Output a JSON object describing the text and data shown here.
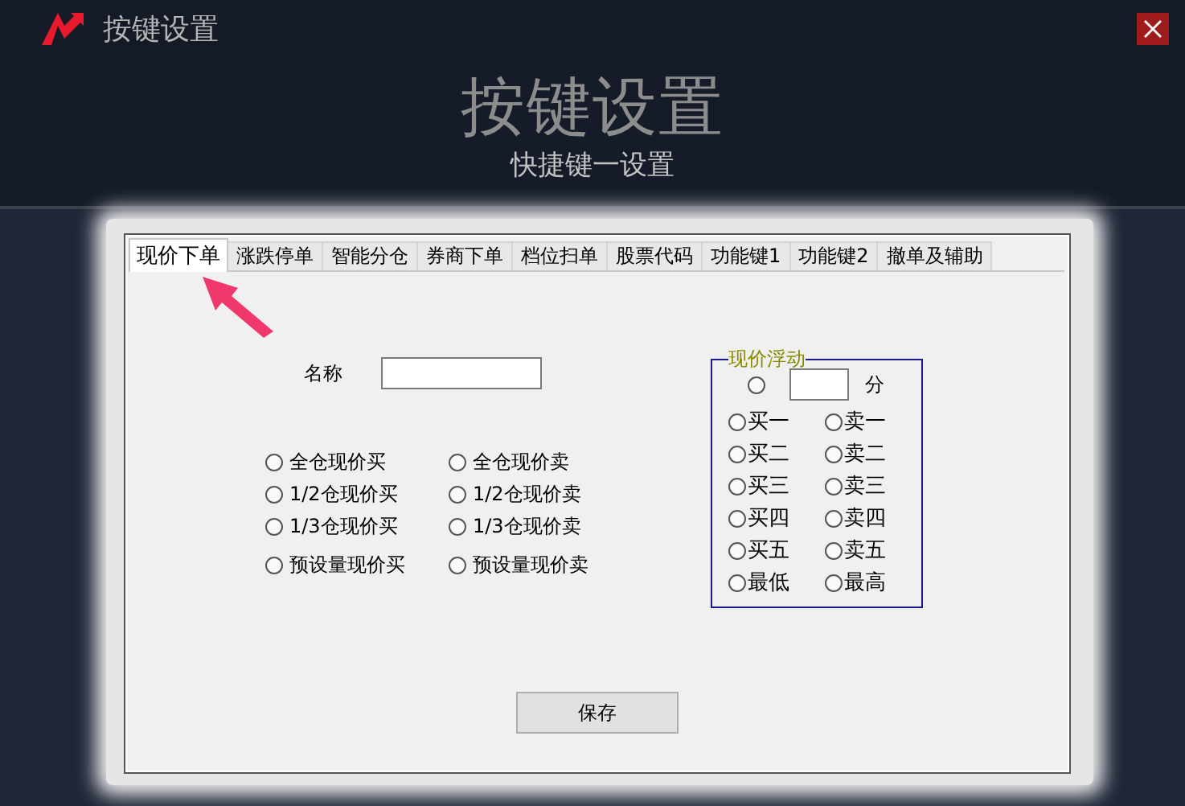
{
  "window": {
    "title": "按键设置"
  },
  "header": {
    "title": "按键设置",
    "subtitle": "快捷键一设置"
  },
  "tabs": [
    {
      "label": "现价下单",
      "selected": true
    },
    {
      "label": "涨跌停单",
      "selected": false
    },
    {
      "label": "智能分仓",
      "selected": false
    },
    {
      "label": "券商下单",
      "selected": false
    },
    {
      "label": "档位扫单",
      "selected": false
    },
    {
      "label": "股票代码",
      "selected": false
    },
    {
      "label": "功能键1",
      "selected": false
    },
    {
      "label": "功能键2",
      "selected": false
    },
    {
      "label": "撤单及辅助",
      "selected": false
    }
  ],
  "name_field": {
    "label": "名称"
  },
  "order_options": [
    {
      "label": "全仓现价买",
      "selected": false
    },
    {
      "label": "全仓现价卖",
      "selected": false
    },
    {
      "label": "1/2仓现价买",
      "selected": false
    },
    {
      "label": "1/2仓现价卖",
      "selected": false
    },
    {
      "label": "1/3仓现价买",
      "selected": false
    },
    {
      "label": "1/3仓现价卖",
      "selected": false
    },
    {
      "label": "预设量现价买",
      "selected": false
    },
    {
      "label": "预设量现价卖",
      "selected": false
    }
  ],
  "price_float": {
    "title": "现价浮动",
    "custom": {
      "selected": false,
      "unit": "分"
    },
    "options": [
      {
        "label": "买一",
        "selected": false
      },
      {
        "label": "卖一",
        "selected": false
      },
      {
        "label": "买二",
        "selected": false
      },
      {
        "label": "卖二",
        "selected": false
      },
      {
        "label": "买三",
        "selected": false
      },
      {
        "label": "卖三",
        "selected": false
      },
      {
        "label": "买四",
        "selected": false
      },
      {
        "label": "卖四",
        "selected": false
      },
      {
        "label": "买五",
        "selected": false
      },
      {
        "label": "卖五",
        "selected": false
      },
      {
        "label": "最低",
        "selected": false
      },
      {
        "label": "最高",
        "selected": false
      }
    ]
  },
  "save_button": {
    "label": "保存"
  }
}
